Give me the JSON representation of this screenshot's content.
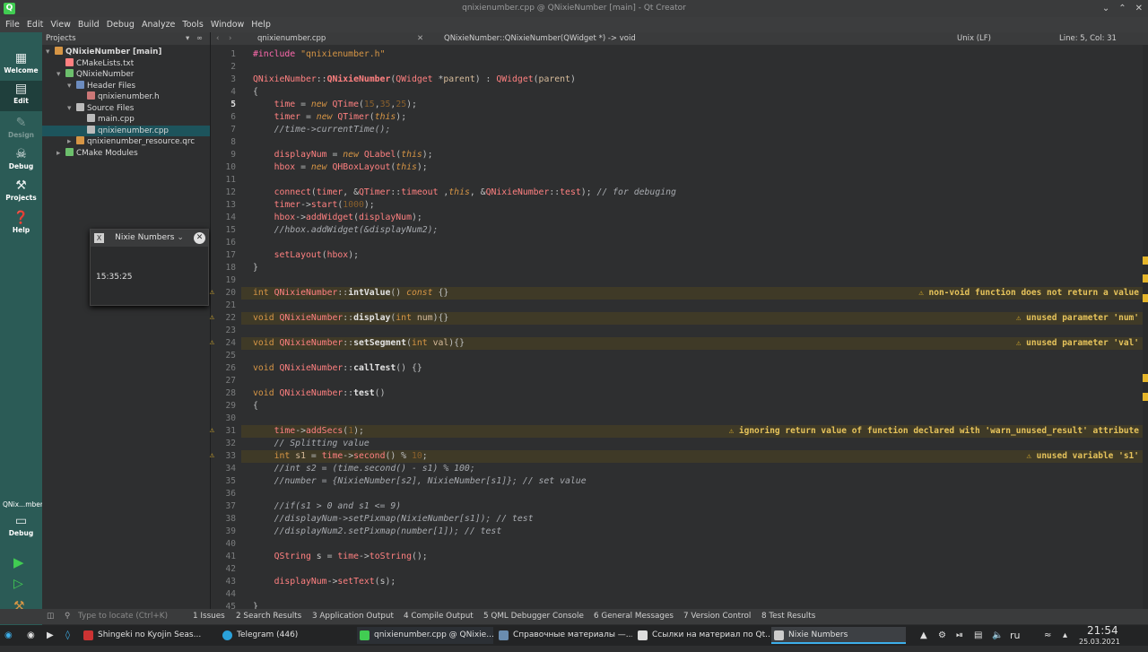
{
  "window": {
    "title": "qnixienumber.cpp @ QNixieNumber [main] - Qt Creator"
  },
  "menu": [
    "File",
    "Edit",
    "View",
    "Build",
    "Debug",
    "Analyze",
    "Tools",
    "Window",
    "Help"
  ],
  "modes": [
    {
      "label": "Welcome",
      "icon": "grid-icon"
    },
    {
      "label": "Edit",
      "icon": "edit-icon"
    },
    {
      "label": "Design",
      "icon": "pen-icon"
    },
    {
      "label": "Debug",
      "icon": "bug-icon"
    },
    {
      "label": "Projects",
      "icon": "wrench-icon"
    },
    {
      "label": "Help",
      "icon": "question-icon"
    }
  ],
  "kit": {
    "name": "QNix...mber",
    "mode": "Debug"
  },
  "projects": {
    "title": "Projects",
    "tree": [
      {
        "label": "QNixieNumber [main]",
        "indent": 0,
        "bold": true
      },
      {
        "label": "CMakeLists.txt",
        "indent": 1
      },
      {
        "label": "QNixieNumber",
        "indent": 1
      },
      {
        "label": "Header Files",
        "indent": 2
      },
      {
        "label": "qnixienumber.h",
        "indent": 3
      },
      {
        "label": "Source Files",
        "indent": 2
      },
      {
        "label": "main.cpp",
        "indent": 3
      },
      {
        "label": "qnixienumber.cpp",
        "indent": 3,
        "selected": true
      },
      {
        "label": "qnixienumber_resource.qrc",
        "indent": 2
      },
      {
        "label": "CMake Modules",
        "indent": 1
      }
    ]
  },
  "editor": {
    "file": "qnixienumber.cpp",
    "symbol": "QNixieNumber::QNixieNumber(QWidget *) -> void",
    "eol": "Unix (LF)",
    "position": "Line: 5, Col: 31"
  },
  "popup": {
    "title": "Nixie Numbers",
    "time": "15:35:25"
  },
  "warnings": {
    "20": "non-void function does not return a value",
    "22": "unused parameter 'num'",
    "24": "unused parameter 'val'",
    "31": "ignoring return value of function declared with 'warn_unused_result' attribute",
    "33": "unused variable 's1'"
  },
  "statusbar": {
    "locator_placeholder": "Type to locate (Ctrl+K)",
    "panes": [
      "1 Issues",
      "2 Search Results",
      "3 Application Output",
      "4 Compile Output",
      "5 QML Debugger Console",
      "6 General Messages",
      "7 Version Control",
      "8 Test Results"
    ]
  },
  "taskbar": {
    "tasks": [
      "Shingeki no Kyojin Seas...",
      "Telegram (446)",
      "qnixienumber.cpp @ QNixie...",
      "Справочные материалы —...",
      "Ссылки на материал по Qt...",
      "Nixie Numbers"
    ],
    "lang": "ru",
    "time": "21:54",
    "date": "25.03.2021"
  },
  "colors": {
    "accent": "#2b5b56",
    "warning": "#e6c35b",
    "selection": "#1d545c"
  }
}
